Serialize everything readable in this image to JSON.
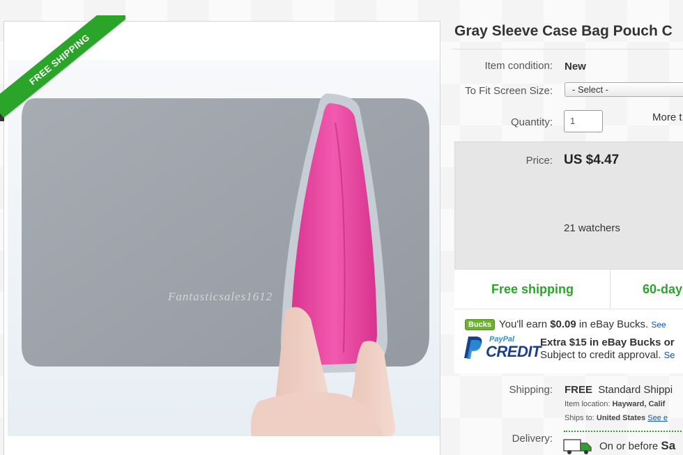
{
  "ribbon": {
    "label": "FREE SHIPPING"
  },
  "image": {
    "watermark": "Fantasticsales1612"
  },
  "product": {
    "title": "Gray Sleeve Case Bag Pouch C",
    "condition_label": "Item condition:",
    "condition_value": "New",
    "fit_label": "To Fit Screen Size:",
    "fit_selected": "- Select -",
    "quantity_label": "Quantity:",
    "quantity_value": "1",
    "more_text": "More t"
  },
  "price": {
    "label": "Price:",
    "value": "US $4.47",
    "watchers": "21 watchers"
  },
  "badges": {
    "free_shipping": "Free shipping",
    "returns": "60-day"
  },
  "bucks": {
    "badge": "Bucks",
    "prefix": "You'll earn ",
    "amount": "$0.09",
    "suffix": " in eBay Bucks.",
    "link": "See"
  },
  "paypal": {
    "paypal_text": "PayPal",
    "credit_text": "CREDIT",
    "offer": "Extra $15 in eBay Bucks or",
    "approval": "Subject to credit approval.",
    "approval_link": "Se"
  },
  "shipping": {
    "label": "Shipping:",
    "cost": "FREE",
    "method": "Standard Shippi",
    "location_label": "Item location:",
    "location_value": "Hayward, Calif",
    "ships_to_label": "Ships to:",
    "ships_to_value": "United States",
    "ships_to_link": "See e"
  },
  "delivery": {
    "label": "Delivery:",
    "text": "On or before",
    "day": "Sa"
  },
  "colors": {
    "accent_green": "#2aa52a",
    "link_blue": "#0654ba",
    "bucks_green": "#6ab42d",
    "sleeve_gray": "#9ea3ab",
    "lining_pink": "#e8479e"
  }
}
